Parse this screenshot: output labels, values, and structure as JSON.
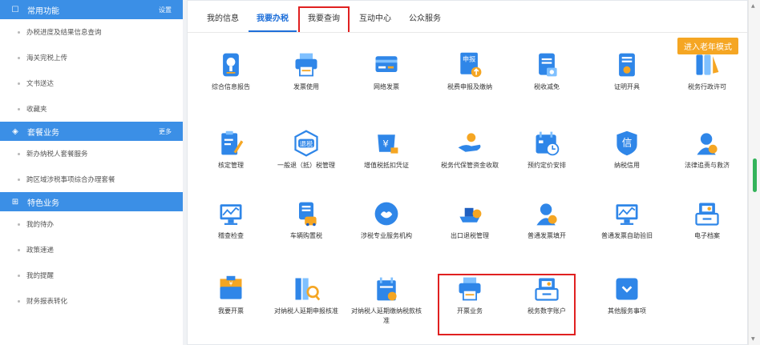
{
  "sidebar": {
    "sections": [
      {
        "icon": "square-icon",
        "glyph": "☐",
        "title": "常用功能",
        "link": "设置",
        "items": [
          "办税进度及结果信息查询",
          "海关完税上传",
          "文书送达",
          "收藏夹"
        ]
      },
      {
        "icon": "layers-icon",
        "glyph": "◈",
        "title": "套餐业务",
        "link": "更多",
        "items": [
          "新办纳税人套餐服务",
          "跨区域涉税事项综合办理套餐"
        ]
      },
      {
        "icon": "grid-icon",
        "glyph": "⊞",
        "title": "特色业务",
        "link": "",
        "items": [
          "我的待办",
          "政策速递",
          "我的提醒",
          "财务报表转化"
        ]
      }
    ]
  },
  "tabs": [
    "我的信息",
    "我要办税",
    "我要查询",
    "互动中心",
    "公众服务"
  ],
  "active_tab": "我要办税",
  "highlighted_tab": "我要查询",
  "elder_mode_label": "进入老年模式",
  "services": [
    {
      "label": "综合信息报告",
      "icon": "info-report-icon"
    },
    {
      "label": "发票使用",
      "icon": "printer-icon"
    },
    {
      "label": "网络发票",
      "icon": "card-icon"
    },
    {
      "label": "税费申报及缴纳",
      "icon": "declare-icon"
    },
    {
      "label": "税收减免",
      "icon": "document-icon"
    },
    {
      "label": "证明开具",
      "icon": "certificate-icon"
    },
    {
      "label": "税务行政许可",
      "icon": "license-icon"
    },
    {
      "label": "核定管理",
      "icon": "edit-doc-icon"
    },
    {
      "label": "一般退（抵）税管理",
      "icon": "refund-icon",
      "badge": "退税"
    },
    {
      "label": "增值税抵扣凭证",
      "icon": "deduct-icon"
    },
    {
      "label": "税务代保管资金收取",
      "icon": "custody-icon"
    },
    {
      "label": "预约定价安排",
      "icon": "calendar-clock-icon"
    },
    {
      "label": "纳税信用",
      "icon": "credit-icon",
      "badge": "信"
    },
    {
      "label": "法律追责与救济",
      "icon": "legal-icon"
    },
    {
      "label": "稽查检查",
      "icon": "monitor-chart-icon"
    },
    {
      "label": "车辆购置税",
      "icon": "vehicle-tax-icon"
    },
    {
      "label": "涉税专业服务机构",
      "icon": "service-agency-icon"
    },
    {
      "label": "出口退税管理",
      "icon": "ship-icon"
    },
    {
      "label": "普通发票填开",
      "icon": "invoice-issue-icon"
    },
    {
      "label": "普通发票自助验旧",
      "icon": "invoice-check-icon"
    },
    {
      "label": "电子档案",
      "icon": "archive-icon"
    },
    {
      "label": "我要开票",
      "icon": "register-icon"
    },
    {
      "label": "对纳税人延期申报核准",
      "icon": "delay-declare-icon"
    },
    {
      "label": "对纳税人延期缴纳税款核准",
      "icon": "delay-pay-icon"
    },
    {
      "label": "开票业务",
      "icon": "printer-icon"
    },
    {
      "label": "税务数字账户",
      "icon": "digital-account-icon"
    },
    {
      "label": "其他服务事项",
      "icon": "other-service-icon"
    }
  ],
  "colors": {
    "accent": "#1e6fd9",
    "sidebar_header": "#3b8fe6",
    "orange": "#f5a623",
    "highlight_border": "#e02020",
    "scroll_thumb": "#33b35a"
  }
}
